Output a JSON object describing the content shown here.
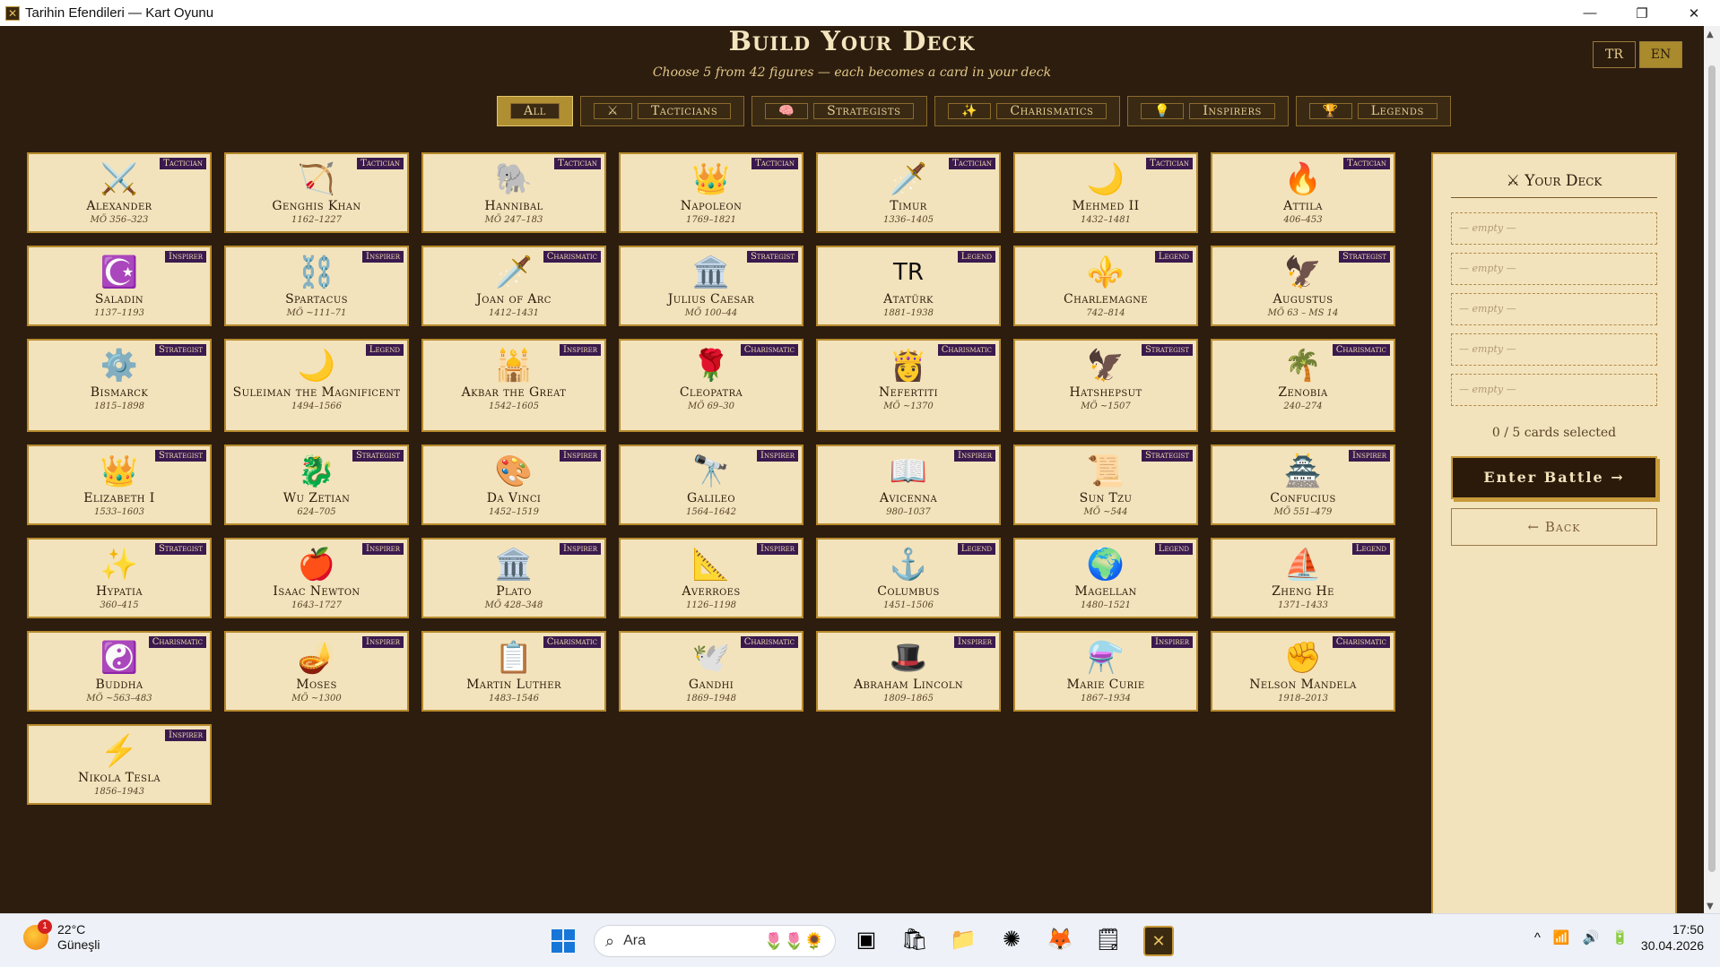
{
  "window": {
    "title": "Tarihin Efendileri — Kart Oyunu",
    "app_icon": "✕",
    "minimize": "—",
    "restore": "❐",
    "close": "✕"
  },
  "language": {
    "tr": "TR",
    "en": "EN",
    "active": "EN"
  },
  "header": {
    "title": "Build Your Deck",
    "subtitle": "Choose 5 from 42 figures — each becomes a card in your deck"
  },
  "filters": [
    {
      "label": "All",
      "icon": "",
      "active": true
    },
    {
      "label": "Tacticians",
      "icon": "⚔",
      "active": false
    },
    {
      "label": "Strategists",
      "icon": "🧠",
      "active": false
    },
    {
      "label": "Charismatics",
      "icon": "✨",
      "active": false
    },
    {
      "label": "Inspirers",
      "icon": "💡",
      "active": false
    },
    {
      "label": "Legends",
      "icon": "🏆",
      "active": false
    }
  ],
  "rows": [
    {
      "height": 90,
      "cards": [
        {
          "name": "Alexander",
          "dates": "MÖ 356–323",
          "badge": "Tactician",
          "emoji": "⚔️"
        },
        {
          "name": "Genghis Khan",
          "dates": "1162–1227",
          "badge": "Tactician",
          "emoji": "🏹"
        },
        {
          "name": "Hannibal",
          "dates": "MÖ 247–183",
          "badge": "Tactician",
          "emoji": "🐘"
        },
        {
          "name": "Napoleon",
          "dates": "1769–1821",
          "badge": "Tactician",
          "emoji": "👑"
        },
        {
          "name": "Timur",
          "dates": "1336–1405",
          "badge": "Tactician",
          "emoji": "🗡️"
        },
        {
          "name": "Mehmed II",
          "dates": "1432–1481",
          "badge": "Tactician",
          "emoji": "🌙"
        },
        {
          "name": "Attila",
          "dates": "406–453",
          "badge": "Tactician",
          "emoji": "🔥"
        }
      ]
    },
    {
      "height": 90,
      "cards": [
        {
          "name": "Saladin",
          "dates": "1137–1193",
          "badge": "Inspirer",
          "emoji": "☪️"
        },
        {
          "name": "Spartacus",
          "dates": "MÖ ~111–71",
          "badge": "Inspirer",
          "emoji": "⛓️"
        },
        {
          "name": "Joan of Arc",
          "dates": "1412–1431",
          "badge": "Charismatic",
          "emoji": "🗡️"
        },
        {
          "name": "Julius Caesar",
          "dates": "MÖ 100–44",
          "badge": "Strategist",
          "emoji": "🏛️"
        },
        {
          "name": "Atatürk",
          "dates": "1881–1938",
          "badge": "Legend",
          "emoji": "TR"
        },
        {
          "name": "Charlemagne",
          "dates": "742–814",
          "badge": "Legend",
          "emoji": "⚜️"
        },
        {
          "name": "Augustus",
          "dates": "MÖ 63 – MS 14",
          "badge": "Strategist",
          "emoji": "🦅"
        }
      ]
    },
    {
      "height": 104,
      "cards": [
        {
          "name": "Bismarck",
          "dates": "1815–1898",
          "badge": "Strategist",
          "emoji": "⚙️"
        },
        {
          "name": "Suleiman the Magnificent",
          "dates": "1494–1566",
          "badge": "Legend",
          "emoji": "🌙"
        },
        {
          "name": "Akbar the Great",
          "dates": "1542–1605",
          "badge": "Inspirer",
          "emoji": "🕌"
        },
        {
          "name": "Cleopatra",
          "dates": "MÖ 69–30",
          "badge": "Charismatic",
          "emoji": "🌹"
        },
        {
          "name": "Nefertiti",
          "dates": "MÖ ~1370",
          "badge": "Charismatic",
          "emoji": "👸"
        },
        {
          "name": "Hatshepsut",
          "dates": "MÖ ~1507",
          "badge": "Strategist",
          "emoji": "🦅"
        },
        {
          "name": "Zenobia",
          "dates": "240–274",
          "badge": "Charismatic",
          "emoji": "🌴"
        }
      ]
    },
    {
      "height": 90,
      "cards": [
        {
          "name": "Elizabeth I",
          "dates": "1533–1603",
          "badge": "Strategist",
          "emoji": "👑"
        },
        {
          "name": "Wu Zetian",
          "dates": "624–705",
          "badge": "Strategist",
          "emoji": "🐉"
        },
        {
          "name": "Da Vinci",
          "dates": "1452–1519",
          "badge": "Inspirer",
          "emoji": "🎨"
        },
        {
          "name": "Galileo",
          "dates": "1564–1642",
          "badge": "Inspirer",
          "emoji": "🔭"
        },
        {
          "name": "Avicenna",
          "dates": "980–1037",
          "badge": "Inspirer",
          "emoji": "📖"
        },
        {
          "name": "Sun Tzu",
          "dates": "MÖ ~544",
          "badge": "Strategist",
          "emoji": "📜"
        },
        {
          "name": "Confucius",
          "dates": "MÖ 551–479",
          "badge": "Inspirer",
          "emoji": "🏯"
        }
      ]
    },
    {
      "height": 90,
      "cards": [
        {
          "name": "Hypatia",
          "dates": "360–415",
          "badge": "Strategist",
          "emoji": "✨"
        },
        {
          "name": "Isaac Newton",
          "dates": "1643–1727",
          "badge": "Inspirer",
          "emoji": "🍎"
        },
        {
          "name": "Plato",
          "dates": "MÖ 428–348",
          "badge": "Inspirer",
          "emoji": "🏛️"
        },
        {
          "name": "Averroes",
          "dates": "1126–1198",
          "badge": "Inspirer",
          "emoji": "📐"
        },
        {
          "name": "Columbus",
          "dates": "1451–1506",
          "badge": "Legend",
          "emoji": "⚓"
        },
        {
          "name": "Magellan",
          "dates": "1480–1521",
          "badge": "Legend",
          "emoji": "🌍"
        },
        {
          "name": "Zheng He",
          "dates": "1371–1433",
          "badge": "Legend",
          "emoji": "⛵"
        }
      ]
    },
    {
      "height": 90,
      "cards": [
        {
          "name": "Buddha",
          "dates": "MÖ ~563–483",
          "badge": "Charismatic",
          "emoji": "☯️"
        },
        {
          "name": "Moses",
          "dates": "MÖ ~1300",
          "badge": "Inspirer",
          "emoji": "🪔"
        },
        {
          "name": "Martin Luther",
          "dates": "1483–1546",
          "badge": "Charismatic",
          "emoji": "📋"
        },
        {
          "name": "Gandhi",
          "dates": "1869–1948",
          "badge": "Charismatic",
          "emoji": "🕊️"
        },
        {
          "name": "Abraham Lincoln",
          "dates": "1809–1865",
          "badge": "Inspirer",
          "emoji": "🎩"
        },
        {
          "name": "Marie Curie",
          "dates": "1867–1934",
          "badge": "Inspirer",
          "emoji": "⚗️"
        },
        {
          "name": "Nelson Mandela",
          "dates": "1918–2013",
          "badge": "Charismatic",
          "emoji": "✊"
        }
      ]
    },
    {
      "height": 90,
      "cards": [
        {
          "name": "Nikola Tesla",
          "dates": "1856–1943",
          "badge": "Inspirer",
          "emoji": "⚡"
        }
      ]
    }
  ],
  "deck": {
    "title": "Your Deck",
    "icon": "⚔",
    "slots": [
      "— empty —",
      "— empty —",
      "— empty —",
      "— empty —",
      "— empty —"
    ],
    "count": "0 / 5 cards selected",
    "enter_label": "Enter Battle →",
    "back_label": "← Back"
  },
  "taskbar": {
    "weather_temp": "22°C",
    "weather_desc": "Güneşli",
    "weather_badge": "1",
    "search_placeholder": "Ara",
    "search_decor": "🌷🌷🌻",
    "apps": [
      {
        "name": "task-view-icon",
        "glyph": "▣"
      },
      {
        "name": "store-icon",
        "glyph": "🛍"
      },
      {
        "name": "file-explorer-icon",
        "glyph": "📁"
      },
      {
        "name": "claude-icon",
        "glyph": "✺"
      },
      {
        "name": "firefox-icon",
        "glyph": "🦊"
      },
      {
        "name": "notepad-icon",
        "glyph": "🗒"
      },
      {
        "name": "card-game-icon",
        "glyph": "✕"
      }
    ],
    "tray_chevron": "^",
    "tray_wifi": "📶",
    "tray_sound": "🔊",
    "tray_battery": "🔋",
    "time": "17:50",
    "date": "30.04.2026"
  }
}
